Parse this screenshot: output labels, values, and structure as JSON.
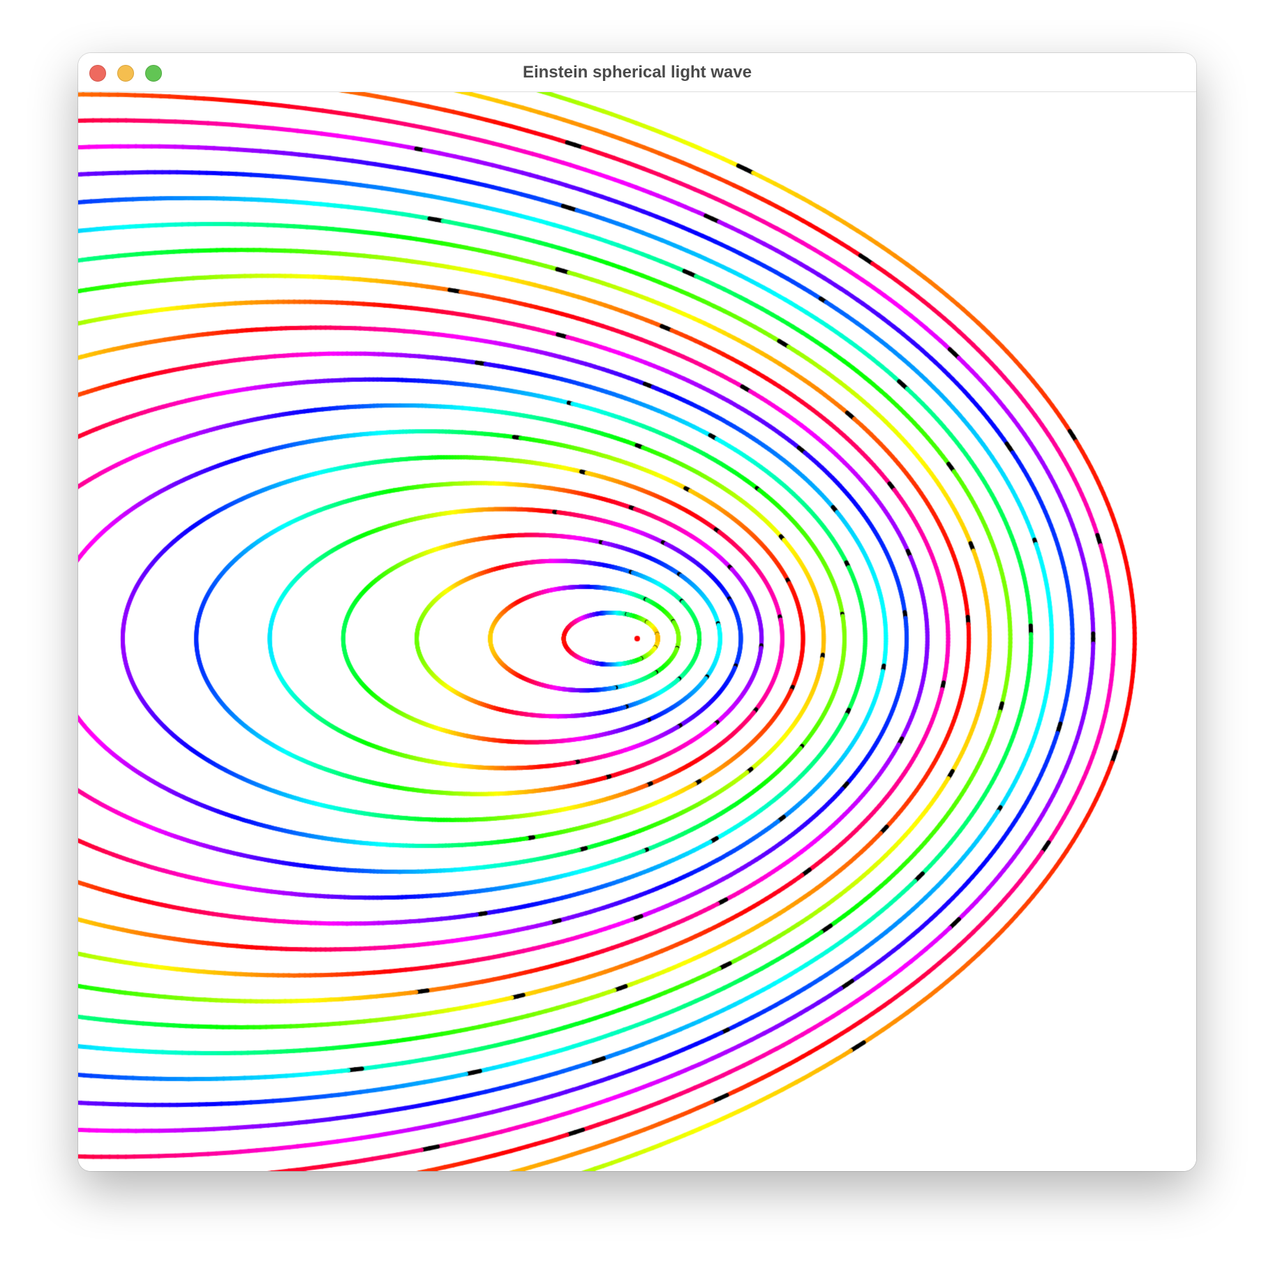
{
  "window": {
    "title": "Einstein spherical light wave"
  },
  "controls": {
    "close": "close-button",
    "minimize": "minimize-button",
    "zoom": "zoom-button"
  },
  "plot": {
    "wave_count": 24,
    "source_color": "#ff0000",
    "background": "#ffffff",
    "node_color": "#000000"
  }
}
